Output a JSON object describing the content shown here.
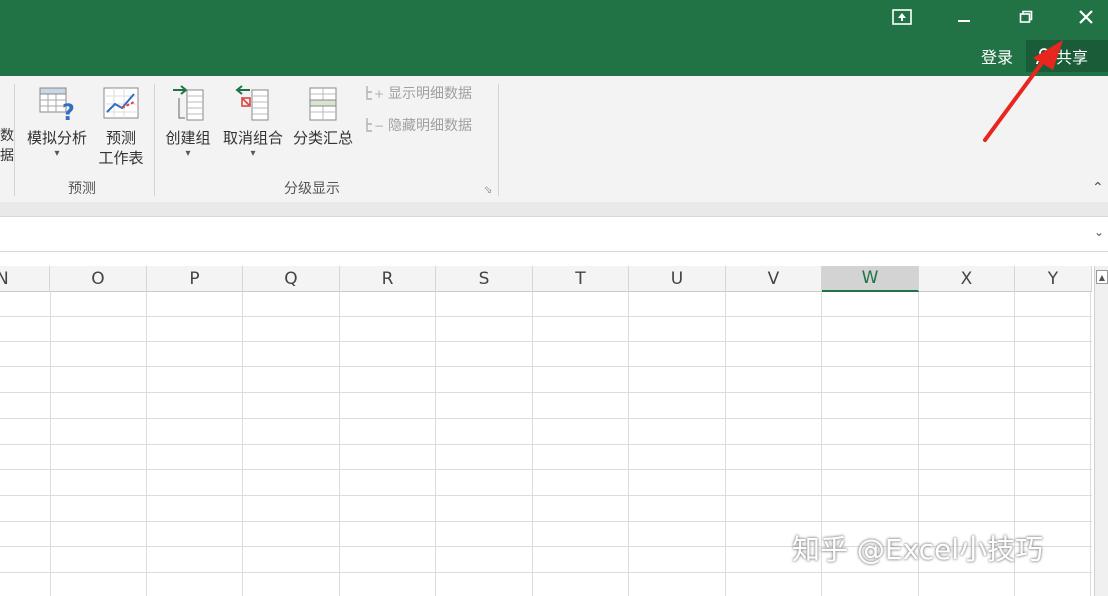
{
  "titlebar": {
    "login": "登录",
    "share": "共享",
    "accent": "#217346"
  },
  "ribbon": {
    "truncated_left": [
      "数",
      "据"
    ],
    "forecast_group": {
      "label": "预测",
      "whatif": "模拟分析",
      "forecast_sheet_line1": "预测",
      "forecast_sheet_line2": "工作表"
    },
    "outline_group": {
      "label": "分级显示",
      "group": "创建组",
      "ungroup": "取消组合",
      "subtotal": "分类汇总",
      "show_detail": "显示明细数据",
      "hide_detail": "隐藏明细数据"
    }
  },
  "grid": {
    "columns": [
      "N",
      "O",
      "P",
      "Q",
      "R",
      "S",
      "T",
      "U",
      "V",
      "W",
      "X",
      "Y"
    ],
    "selected_column": "W"
  },
  "watermark": "知乎 @Excel小技巧",
  "icons": {
    "ribbon_display": "ribbon-display-options-icon",
    "minimize": "minimize-icon",
    "restore": "restore-icon",
    "close": "close-icon",
    "share": "person-icon",
    "annotation": "red-arrow-icon"
  }
}
